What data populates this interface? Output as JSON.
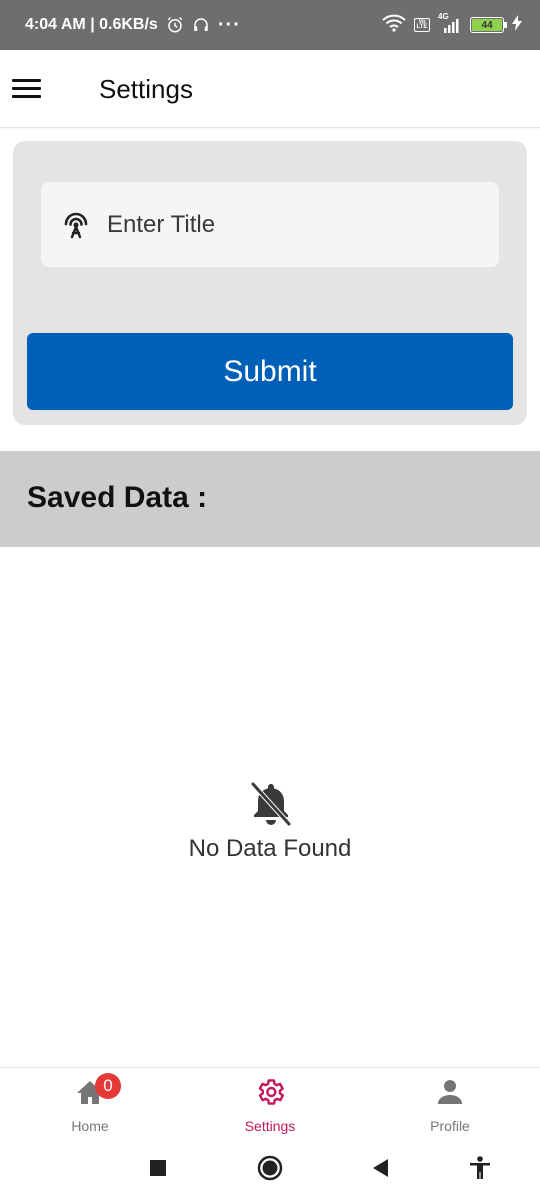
{
  "status_bar": {
    "time_info": "4:04 AM | 0.6KB/s",
    "more": "···",
    "network_type": "4G",
    "volte": "Vo LTE",
    "battery_level": "44"
  },
  "app_bar": {
    "title": "Settings",
    "menu_icon": "hamburger-menu-icon"
  },
  "form": {
    "title_input": {
      "placeholder": "Enter Title",
      "value": "",
      "icon": "antenna-icon"
    },
    "submit_label": "Submit",
    "submit_color": "#005fb7"
  },
  "saved_data": {
    "heading": "Saved Data :"
  },
  "empty_state": {
    "icon": "notifications-off-icon",
    "message": "No Data Found"
  },
  "bottom_nav": {
    "items": [
      {
        "label": "Home",
        "icon": "home-icon",
        "badge": "0",
        "active": false
      },
      {
        "label": "Settings",
        "icon": "gear-icon",
        "active": true
      },
      {
        "label": "Profile",
        "icon": "person-icon",
        "active": false
      }
    ],
    "active_color": "#c2185b",
    "badge_color": "#e53935"
  },
  "system_nav": {
    "buttons": [
      "recents-icon",
      "home-circle-icon",
      "back-icon",
      "accessibility-icon"
    ]
  }
}
